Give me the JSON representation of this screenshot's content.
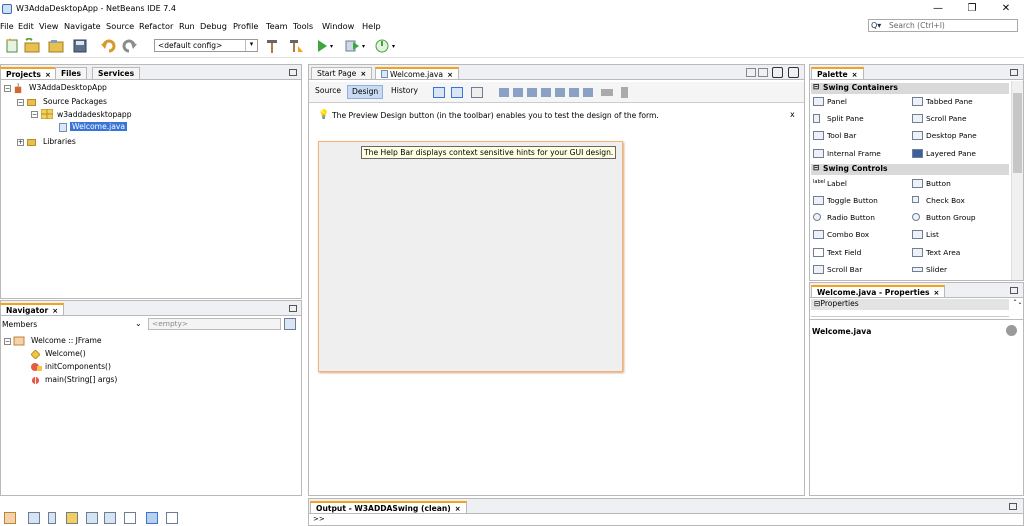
{
  "window": {
    "title": "W3AddaDesktopApp - NetBeans IDE 7.4",
    "minimize_glyph": "—",
    "maximize_glyph": "❐",
    "close_glyph": "✕"
  },
  "menubar": [
    "File",
    "Edit",
    "View",
    "Navigate",
    "Source",
    "Refactor",
    "Run",
    "Debug",
    "Profile",
    "Team",
    "Tools",
    "Window",
    "Help"
  ],
  "search": {
    "placeholder": "Search (Ctrl+I)",
    "icon": "search-icon"
  },
  "toolbar": {
    "config_value": "<default config>"
  },
  "projects_panel": {
    "tabs": [
      "Projects",
      "Files",
      "Services"
    ],
    "close_glyph": "×",
    "tree": [
      {
        "label": "W3AddaDesktopApp",
        "level": 0
      },
      {
        "label": "Source Packages",
        "level": 1
      },
      {
        "label": "w3addadesktopapp",
        "level": 2
      },
      {
        "label": "Welcome.java",
        "level": 3,
        "selected": true
      },
      {
        "label": "Libraries",
        "level": 1
      }
    ]
  },
  "navigator": {
    "title": "Navigator",
    "members_label": "Members",
    "empty_label": "<empty>",
    "tree": [
      {
        "label": "Welcome :: JFrame"
      },
      {
        "label": "Welcome()"
      },
      {
        "label": "initComponents()"
      },
      {
        "label": "main(String[] args)"
      }
    ]
  },
  "editor": {
    "tabs": [
      "Start Page",
      "Welcome.java"
    ],
    "view_buttons": [
      "Source",
      "Design",
      "History"
    ],
    "hint": "The Preview Design button (in the toolbar) enables you to test the design of the form.",
    "hint_close": "x",
    "tooltip": "The Help Bar displays context sensitive hints for your GUI design."
  },
  "palette": {
    "title": "Palette",
    "categories": [
      {
        "name": "Swing Containers",
        "items": [
          "Panel",
          "Tabbed Pane",
          "Split Pane",
          "Scroll Pane",
          "Tool Bar",
          "Desktop Pane",
          "Internal Frame",
          "Layered Pane"
        ]
      },
      {
        "name": "Swing Controls",
        "items": [
          "Label",
          "Button",
          "Toggle Button",
          "Check Box",
          "Radio Button",
          "Button Group",
          "Combo Box",
          "List",
          "Text Field",
          "Text Area",
          "Scroll Bar",
          "Slider"
        ]
      }
    ]
  },
  "properties": {
    "title": "Welcome.java - Properties",
    "section": "Properties",
    "file_label": "Welcome.java"
  },
  "output": {
    "title": "Output - W3ADDASwing (clean)",
    "prompt": ">>"
  },
  "colors": {
    "accent": "#f4a21d",
    "selection": "#3875d7"
  }
}
